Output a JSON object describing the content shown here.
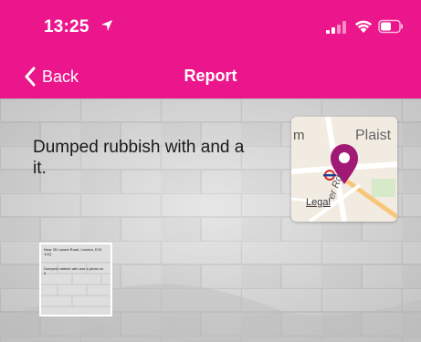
{
  "status_bar": {
    "time": "13:25",
    "icons": [
      "location-arrow-icon",
      "signal-icon",
      "wifi-icon",
      "battery-icon"
    ]
  },
  "nav": {
    "back_label": "Back",
    "title": "Report"
  },
  "report": {
    "description": "Dumped rubbish with and a",
    "description_line2": "it.",
    "map": {
      "label_left": "m",
      "label_right": "Plaist",
      "legal": "Legal",
      "road": "er Rd"
    },
    "photo": {
      "address": "Near 35 Lanark Road, London, E15 1UQ",
      "text": "Dumped rubbish with and a photo on it"
    }
  },
  "colors": {
    "brand": "#ec168c",
    "pin": "#a01a75",
    "text": "#1a1a1a"
  }
}
